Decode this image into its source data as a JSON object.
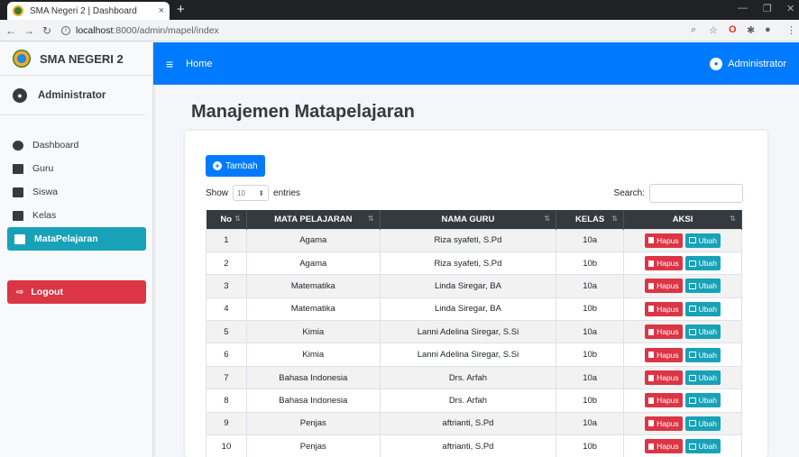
{
  "browser": {
    "tab_title": "SMA Negeri 2 | Dashboard",
    "tab_close": "×",
    "new_tab": "+",
    "url_host": "localhost",
    "url_path": ":8000/admin/mapel/index"
  },
  "sidebar": {
    "brand": "SMA NEGERI 2",
    "user": "Administrator",
    "items": [
      {
        "label": "Dashboard",
        "icon": "dashboard-icon"
      },
      {
        "label": "Guru",
        "icon": "book-icon"
      },
      {
        "label": "Siswa",
        "icon": "book-icon"
      },
      {
        "label": "Kelas",
        "icon": "book-icon"
      },
      {
        "label": "MataPelajaran",
        "icon": "book-icon",
        "active": true
      }
    ],
    "logout": "Logout"
  },
  "navbar": {
    "home": "Home",
    "user": "Administrator"
  },
  "main": {
    "title": "Manajemen Matapelajaran",
    "add_button": "Tambah",
    "show_label": "Show",
    "entries_value": "10",
    "entries_label": "entries",
    "search_label": "Search:",
    "columns": [
      "No",
      "MATA PELAJARAN",
      "NAMA GURU",
      "KELAS",
      "AKSI"
    ],
    "hapus_label": "Hapus",
    "ubah_label": "Ubah",
    "rows": [
      {
        "no": "1",
        "mapel": "Agama",
        "guru": "Riza syafeti, S.Pd",
        "kelas": "10a"
      },
      {
        "no": "2",
        "mapel": "Agama",
        "guru": "Riza syafeti, S.Pd",
        "kelas": "10b"
      },
      {
        "no": "3",
        "mapel": "Matematika",
        "guru": "Linda Siregar, BA",
        "kelas": "10a"
      },
      {
        "no": "4",
        "mapel": "Matematika",
        "guru": "Linda Siregar, BA",
        "kelas": "10b"
      },
      {
        "no": "5",
        "mapel": "Kimia",
        "guru": "Lanni Adelina Siregar, S.Si",
        "kelas": "10a"
      },
      {
        "no": "6",
        "mapel": "Kimia",
        "guru": "Lanni Adelina Siregar, S.Si",
        "kelas": "10b"
      },
      {
        "no": "7",
        "mapel": "Bahasa Indonesia",
        "guru": "Drs. Arfah",
        "kelas": "10a"
      },
      {
        "no": "8",
        "mapel": "Bahasa Indonesia",
        "guru": "Drs. Arfah",
        "kelas": "10b"
      },
      {
        "no": "9",
        "mapel": "Penjas",
        "guru": "aftrianti, S.Pd",
        "kelas": "10a"
      },
      {
        "no": "10",
        "mapel": "Penjas",
        "guru": "aftrianti, S.Pd",
        "kelas": "10b"
      }
    ]
  },
  "colors": {
    "navbar": "#007bff",
    "active_menu": "#17a2b8",
    "logout": "#dc3545",
    "table_header": "#343a40"
  }
}
